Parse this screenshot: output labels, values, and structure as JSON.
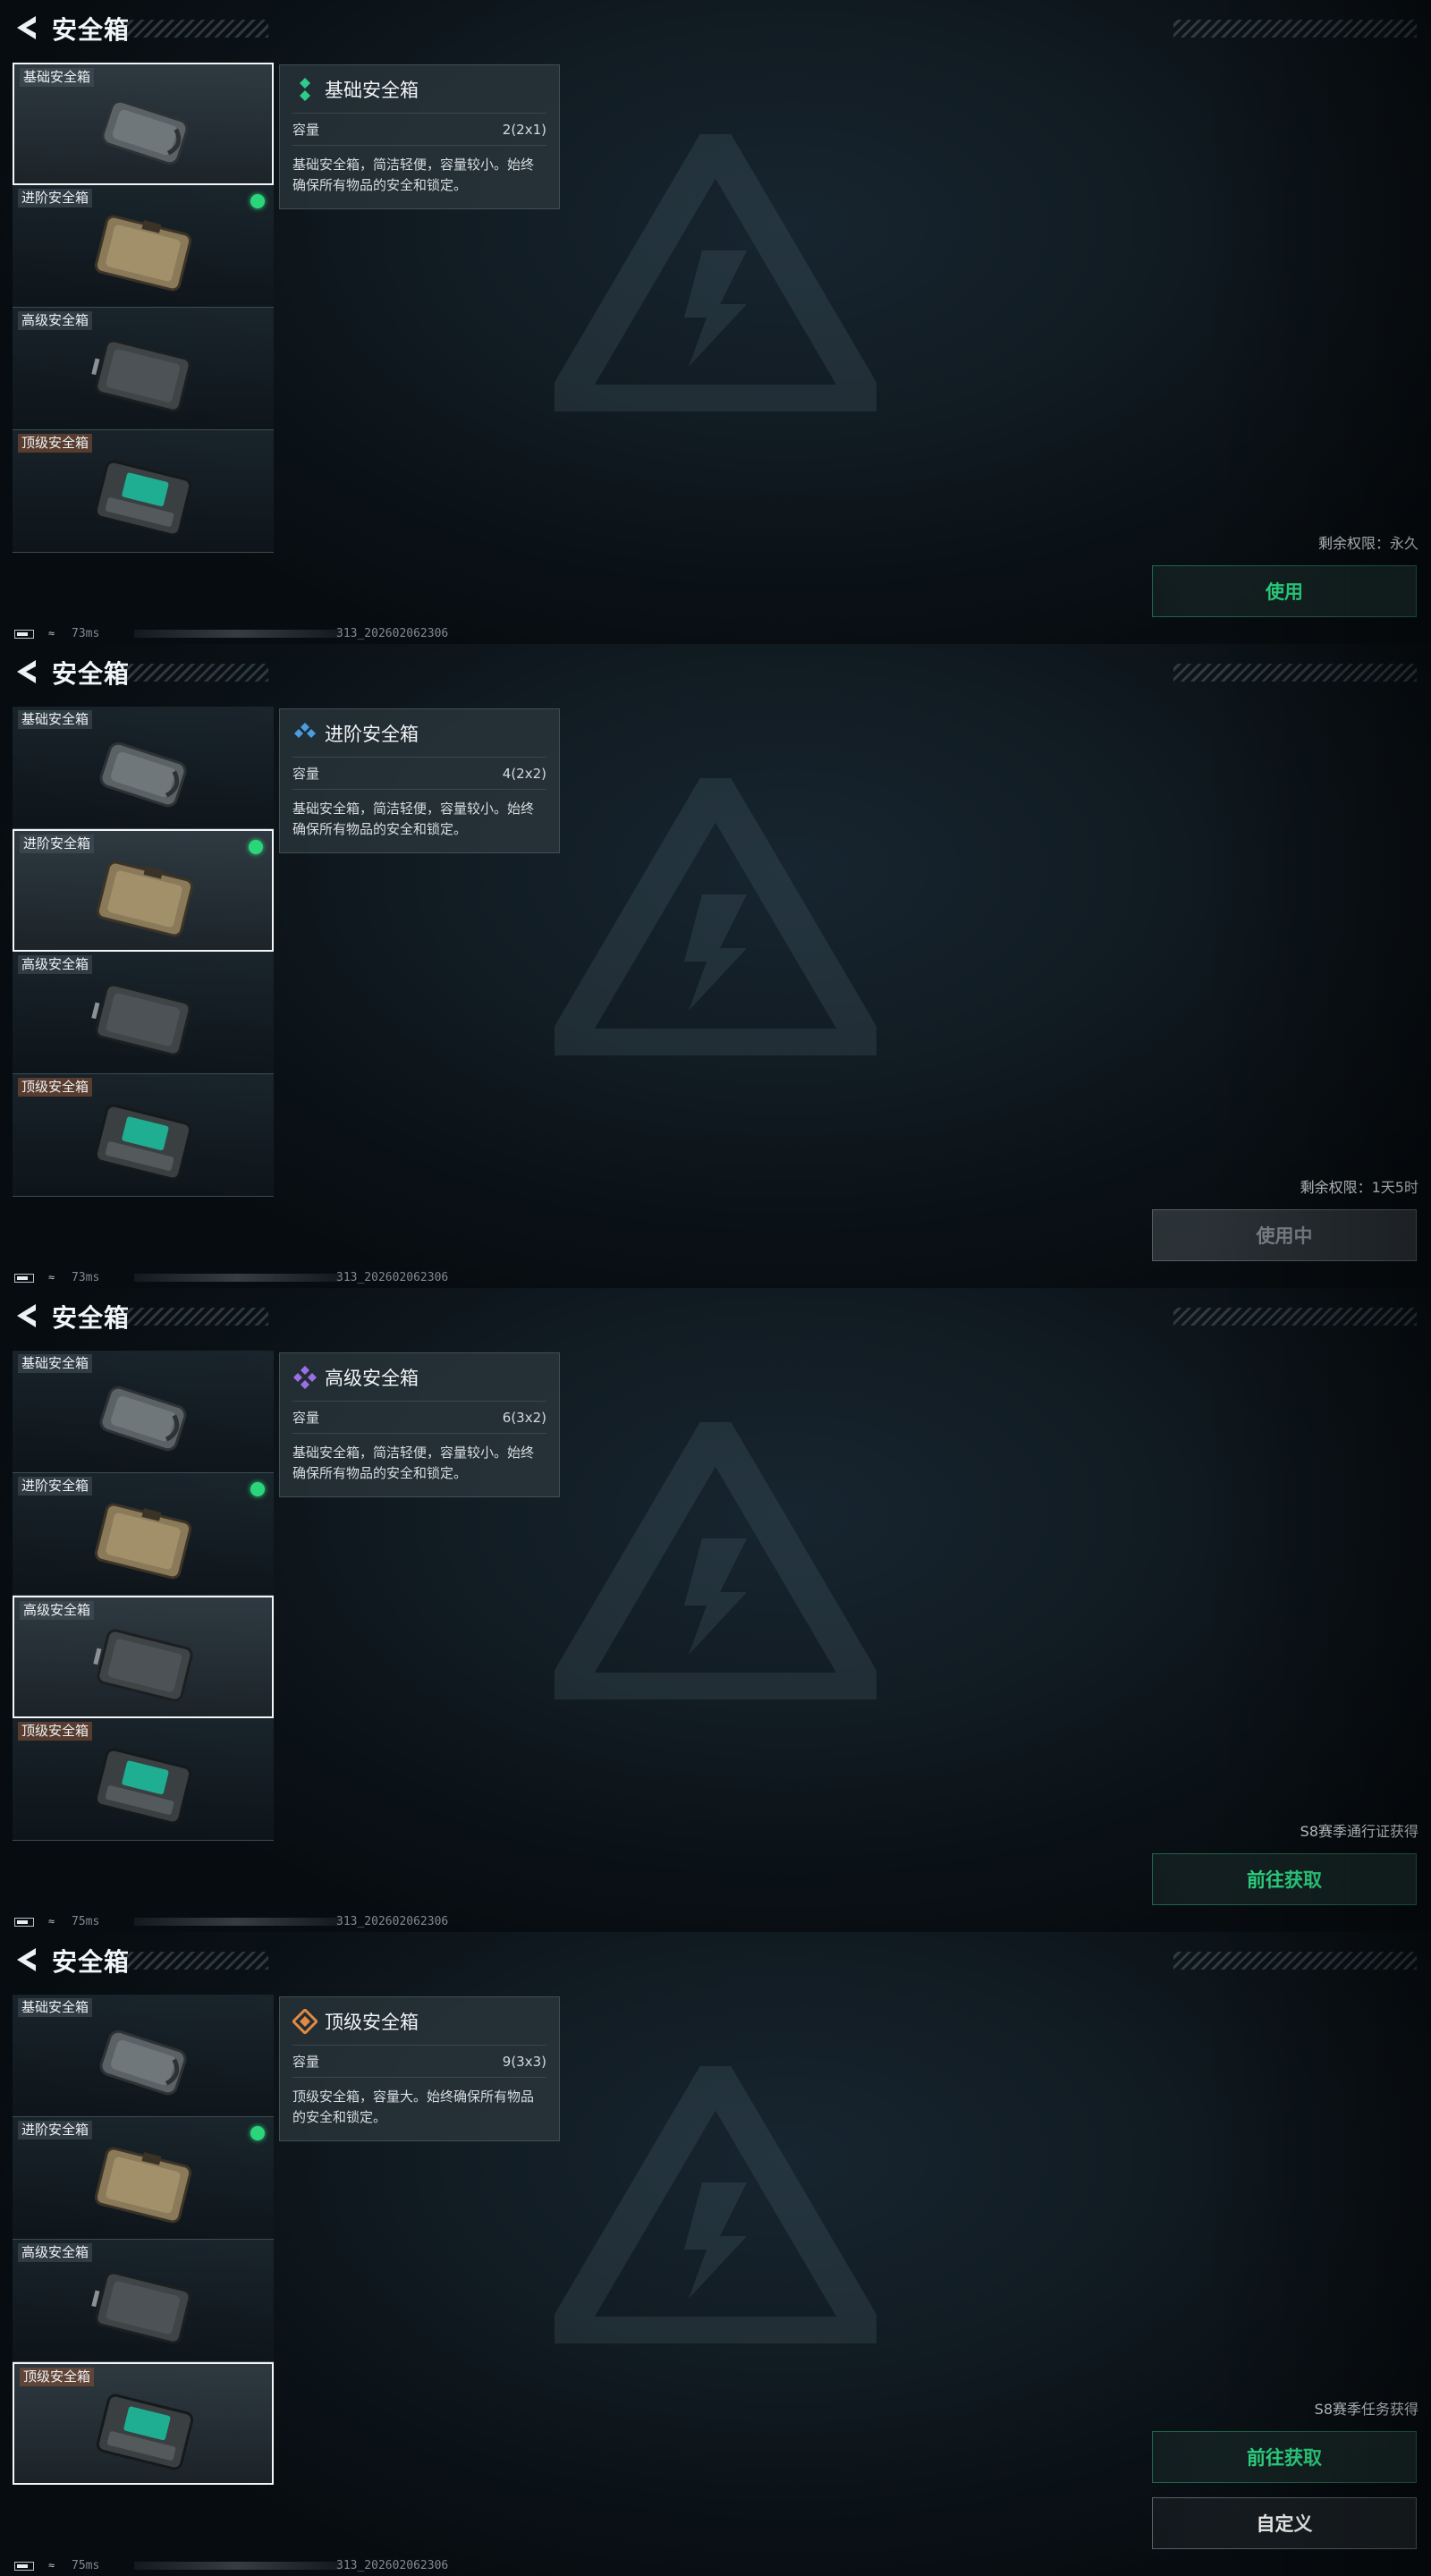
{
  "app": {
    "title": "安全箱"
  },
  "items": [
    {
      "label": "基础安全箱"
    },
    {
      "label": "进阶安全箱"
    },
    {
      "label": "高级安全箱"
    },
    {
      "label": "顶级安全箱"
    }
  ],
  "panels": [
    {
      "detail": {
        "name": "基础安全箱",
        "capacity_label": "容量",
        "capacity_value": "2(2x1)",
        "description": "基础安全箱，简洁轻便，容量较小。始终确保所有物品的安全和锁定。",
        "icon": "green-diamond-icon"
      },
      "status_text": "剩余权限：永久",
      "buttons": [
        {
          "label": "使用",
          "kind": "primary"
        }
      ],
      "footer": {
        "ping": "73ms",
        "version": "313_202602062306"
      }
    },
    {
      "detail": {
        "name": "进阶安全箱",
        "capacity_label": "容量",
        "capacity_value": "4(2x2)",
        "description": "基础安全箱，简洁轻便，容量较小。始终确保所有物品的安全和锁定。",
        "icon": "blue-diamond-icon"
      },
      "status_text": "剩余权限：1天5时",
      "buttons": [
        {
          "label": "使用中",
          "kind": "disabled"
        }
      ],
      "footer": {
        "ping": "73ms",
        "version": "313_202602062306"
      }
    },
    {
      "detail": {
        "name": "高级安全箱",
        "capacity_label": "容量",
        "capacity_value": "6(3x2)",
        "description": "基础安全箱，简洁轻便，容量较小。始终确保所有物品的安全和锁定。",
        "icon": "purple-diamond-icon"
      },
      "status_text": "S8赛季通行证获得",
      "buttons": [
        {
          "label": "前往获取",
          "kind": "primary"
        }
      ],
      "footer": {
        "ping": "75ms",
        "version": "313_202602062306"
      }
    },
    {
      "detail": {
        "name": "顶级安全箱",
        "capacity_label": "容量",
        "capacity_value": "9(3x3)",
        "description": "顶级安全箱，容量大。始终确保所有物品的安全和锁定。",
        "icon": "orange-diamond-icon"
      },
      "status_text": "S8赛季任务获得",
      "buttons": [
        {
          "label": "前往获取",
          "kind": "primary"
        },
        {
          "label": "自定义",
          "kind": "secondary"
        }
      ],
      "footer": {
        "ping": "75ms",
        "version": "313_202602062306"
      }
    }
  ],
  "colors": {
    "accent_green": "#2fe08a",
    "equipped_dot": "#2bd67b",
    "rarity_basic": "#2ecb8a",
    "rarity_advanced": "#4a9de0",
    "rarity_high": "#9b6fe6",
    "rarity_top": "#e08a45"
  }
}
